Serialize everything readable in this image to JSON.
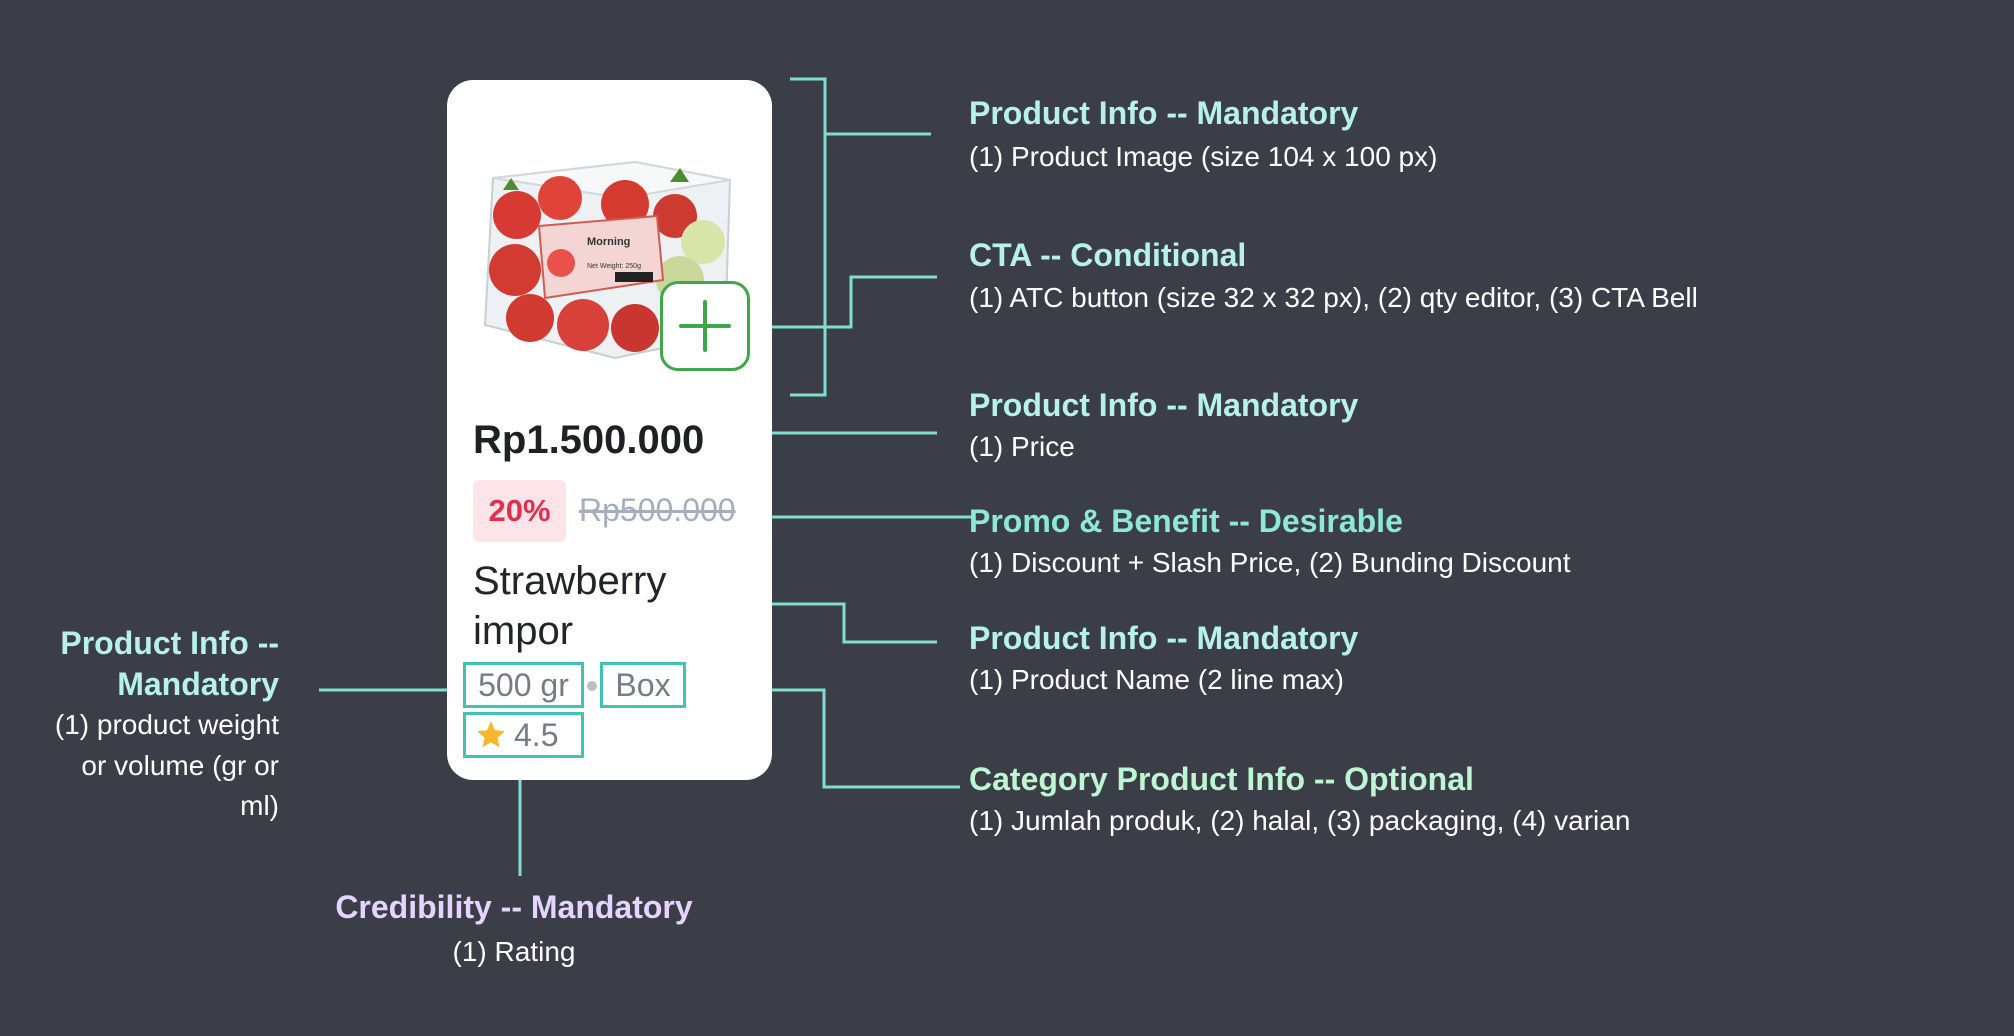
{
  "card": {
    "price": "Rp1.500.000",
    "discount_percent": "20%",
    "slash_price": "Rp500.000",
    "product_name": "Strawberry impor",
    "weight": "500 gr",
    "packaging": "Box",
    "rating": "4.5",
    "label_brand": "Morning",
    "label_weight": "Net Weight: 250g"
  },
  "annotations": {
    "image": {
      "title": "Product Info -- Mandatory",
      "desc": "(1) Product Image (size 104 x 100 px)"
    },
    "cta": {
      "title": "CTA -- Conditional",
      "desc": "(1) ATC button (size 32 x 32 px), (2) qty editor, (3) CTA Bell"
    },
    "price": {
      "title": "Product Info -- Mandatory",
      "desc": "(1) Price"
    },
    "promo": {
      "title": "Promo & Benefit -- Desirable",
      "desc": "(1) Discount + Slash Price, (2) Bunding Discount"
    },
    "name": {
      "title": "Product Info -- Mandatory",
      "desc": "(1) Product Name (2 line max)"
    },
    "category": {
      "title": "Category Product Info -- Optional",
      "desc": "(1) Jumlah produk, (2) halal, (3) packaging, (4) varian"
    },
    "weight": {
      "title_line1": "Product Info --",
      "title_line2": "Mandatory",
      "desc_line1": "(1) product weight",
      "desc_line2": "or volume (gr or",
      "desc_line3": "ml)"
    },
    "credibility": {
      "title": "Credibility -- Mandatory",
      "desc": "(1) Rating"
    }
  },
  "colors": {
    "background": "#3b3e47",
    "connector": "#7fded0",
    "atc_green": "#3fa64a",
    "discount_red": "#e0304e",
    "star": "#f5b82e"
  },
  "icons": {
    "add": "plus-icon",
    "rating": "star-icon"
  }
}
